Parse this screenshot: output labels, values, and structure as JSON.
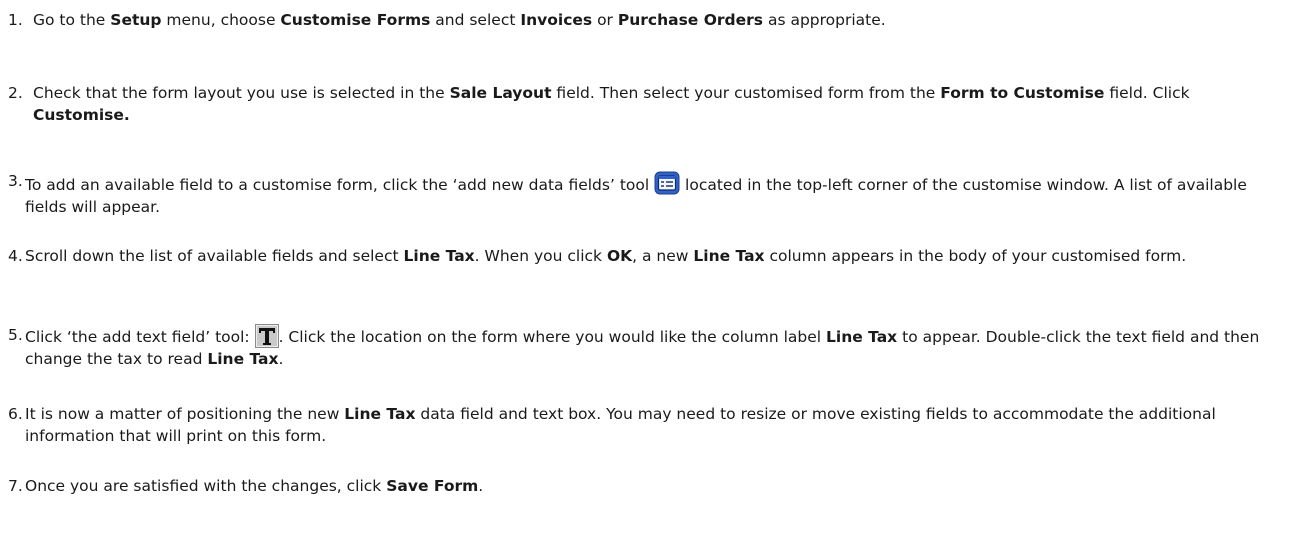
{
  "steps": [
    {
      "number": "1.",
      "segments": [
        {
          "t": "Go to the ",
          "b": false
        },
        {
          "t": "Setup",
          "b": true
        },
        {
          "t": " menu, choose ",
          "b": false
        },
        {
          "t": "Customise Forms",
          "b": true
        },
        {
          "t": " and select ",
          "b": false
        },
        {
          "t": "Invoices",
          "b": true
        },
        {
          "t": " or ",
          "b": false
        },
        {
          "t": "Purchase Orders",
          "b": true
        },
        {
          "t": " as appropriate.",
          "b": false
        }
      ]
    },
    {
      "number": "2.",
      "segments": [
        {
          "t": "Check that the form layout you use is selected in the ",
          "b": false
        },
        {
          "t": "Sale Layout",
          "b": true
        },
        {
          "t": " field. Then select your customised form from the ",
          "b": false
        },
        {
          "t": "Form to Customise",
          "b": true
        },
        {
          "t": " field. Click ",
          "b": false
        },
        {
          "t": "Customise.",
          "b": true
        }
      ]
    },
    {
      "number": "3.",
      "segments": [
        {
          "t": "To add an available field to a customise form, click the ‘add new data fields’ tool ",
          "b": false
        },
        {
          "icon": "add-data-field-icon"
        },
        {
          "t": " located in the top-left corner of the customise window. A list of available fields will appear.",
          "b": false
        }
      ]
    },
    {
      "number": "4.",
      "segments": [
        {
          "t": "Scroll down the list of available fields and select ",
          "b": false
        },
        {
          "t": "Line Tax",
          "b": true
        },
        {
          "t": ". When you click ",
          "b": false
        },
        {
          "t": "OK",
          "b": true
        },
        {
          "t": ", a new ",
          "b": false
        },
        {
          "t": "Line Tax",
          "b": true
        },
        {
          "t": " column appears in the body of your customised form.",
          "b": false
        }
      ]
    },
    {
      "number": "5.",
      "segments": [
        {
          "t": "Click ‘the add text field’ tool: ",
          "b": false
        },
        {
          "icon": "text-field-tool-icon"
        },
        {
          "t": ". Click the location on the form where you would like the column label ",
          "b": false
        },
        {
          "t": "Line Tax",
          "b": true
        },
        {
          "t": " to appear. Double-click the text field and then change the tax to read ",
          "b": false
        },
        {
          "t": "Line Tax",
          "b": true
        },
        {
          "t": ".",
          "b": false
        }
      ]
    },
    {
      "number": "6.",
      "segments": [
        {
          "t": "It is now a matter of positioning the new ",
          "b": false
        },
        {
          "t": "Line Tax",
          "b": true
        },
        {
          "t": " data field and text box. You may need to resize or move existing fields to accommodate the additional information that will print on this form.",
          "b": false
        }
      ]
    },
    {
      "number": "7.",
      "segments": [
        {
          "t": "Once you are satisfied with the changes, click ",
          "b": false
        },
        {
          "t": "Save Form",
          "b": true
        },
        {
          "t": ".",
          "b": false
        }
      ]
    }
  ]
}
